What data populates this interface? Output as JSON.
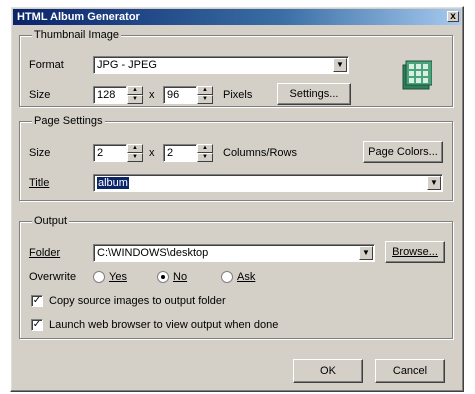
{
  "window": {
    "title": "HTML Album Generator",
    "close_glyph": "x"
  },
  "thumbnail": {
    "legend": "Thumbnail Image",
    "format_label": "Format",
    "format_value": "JPG - JPEG",
    "size_label": "Size",
    "width": "128",
    "height": "96",
    "times": "x",
    "units": "Pixels",
    "settings_button": "Settings..."
  },
  "page_settings": {
    "legend": "Page Settings",
    "size_label": "Size",
    "columns": "2",
    "rows": "2",
    "times": "x",
    "units": "Columns/Rows",
    "page_colors_button": "Page Colors...",
    "title_label": "Title",
    "title_value": "album"
  },
  "output": {
    "legend": "Output",
    "folder_label": "Folder",
    "folder_value": "C:\\WINDOWS\\desktop",
    "browse_button": "Browse...",
    "overwrite_label": "Overwrite",
    "overwrite_options": [
      "Yes",
      "No",
      "Ask"
    ],
    "overwrite_selected": "No",
    "copy_checkbox": "Copy source images to output folder",
    "copy_checked": true,
    "launch_checkbox": "Launch web browser to view output when done",
    "launch_checked": true
  },
  "buttons": {
    "ok": "OK",
    "cancel": "Cancel"
  },
  "icons": {
    "dropdown": "dropdown-arrow-icon",
    "spin": "spin-arrows-icon",
    "album": "thumbnail-grid-icon"
  },
  "colors": {
    "title_gradient_start": "#0a246a",
    "title_gradient_end": "#a6caf0",
    "face": "#d4d0c8",
    "selection": "#0a246a",
    "icon_green": "#2e7d5b"
  }
}
